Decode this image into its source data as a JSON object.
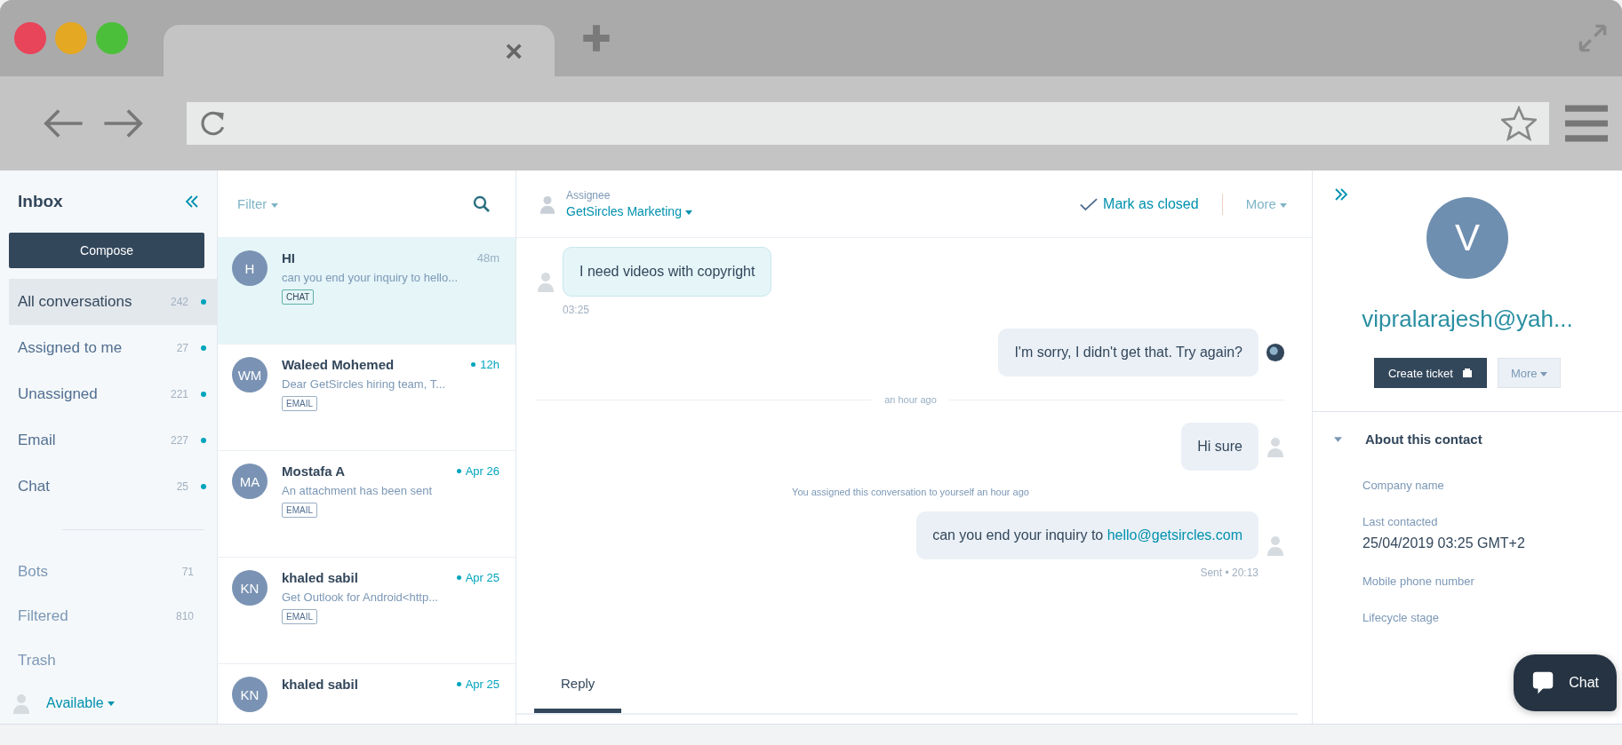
{
  "browser": {
    "tab": {
      "close": "×"
    }
  },
  "sidebar": {
    "title": "Inbox",
    "compose": "Compose",
    "items": [
      {
        "label": "All conversations",
        "count": "242",
        "dot": true,
        "selected": true
      },
      {
        "label": "Assigned to me",
        "count": "27",
        "dot": true,
        "selected": false
      },
      {
        "label": "Unassigned",
        "count": "221",
        "dot": true,
        "selected": false
      },
      {
        "label": "Email",
        "count": "227",
        "dot": true,
        "selected": false
      },
      {
        "label": "Chat",
        "count": "25",
        "dot": true,
        "selected": false
      }
    ],
    "secondary": [
      {
        "label": "Bots",
        "count": "71",
        "selected": false
      },
      {
        "label": "Filtered",
        "count": "810",
        "selected": false
      },
      {
        "label": "Trash",
        "selected": false
      }
    ],
    "status": "Available"
  },
  "list": {
    "filter": "Filter",
    "items": [
      {
        "initials": "H",
        "name": "HI",
        "time": "48m",
        "unread": false,
        "snippet": "can you end your inquiry to hello...",
        "channel": "CHAT",
        "selected": true
      },
      {
        "initials": "WM",
        "name": "Waleed Mohemed",
        "time": "12h",
        "unread": true,
        "snippet": "Dear GetSircles hiring team, T...",
        "channel": "EMAIL",
        "selected": false
      },
      {
        "initials": "MA",
        "name": "Mostafa A",
        "time": "Apr 26",
        "unread": true,
        "snippet": "An attachment has been sent",
        "channel": "EMAIL",
        "selected": false
      },
      {
        "initials": "KN",
        "name": "khaled sabil",
        "time": "Apr 25",
        "unread": true,
        "snippet": "Get Outlook for Android<http...",
        "channel": "EMAIL",
        "selected": false
      },
      {
        "initials": "KN",
        "name": "khaled sabil",
        "time": "Apr 25",
        "unread": true,
        "selected": false
      }
    ]
  },
  "chat": {
    "assignee_label": "Assignee",
    "assignee": "GetSircles Marketing",
    "mark_closed": "Mark as closed",
    "more": "More",
    "messages": [
      {
        "kind": "incoming",
        "text": "I need videos with copyright",
        "meta": "03:25"
      },
      {
        "kind": "bot",
        "text": "I'm sorry, I didn't get that. Try again?"
      },
      {
        "kind": "divider",
        "text": "an hour ago"
      },
      {
        "kind": "outgoing",
        "text": "Hi sure"
      },
      {
        "kind": "note",
        "text": "You assigned this conversation to yourself an hour ago"
      },
      {
        "kind": "outgoing",
        "prefix": "can you end your inquiry to",
        "link": "hello@getsircles.com",
        "meta": "Sent • 20:13"
      }
    ],
    "tabs": [
      {
        "label": "Reply",
        "selected": true
      }
    ]
  },
  "contact": {
    "initial": "V",
    "email": "vipralarajesh@yah...",
    "create_ticket": "Create ticket",
    "more": "More",
    "section": "About this contact",
    "fields": [
      {
        "label": "Company name"
      },
      {
        "label": "Last contacted",
        "value": "25/04/2019 03:25 GMT+2"
      },
      {
        "label": "Mobile phone number"
      },
      {
        "label": "Lifecycle stage"
      }
    ],
    "chat_button": "Chat"
  }
}
